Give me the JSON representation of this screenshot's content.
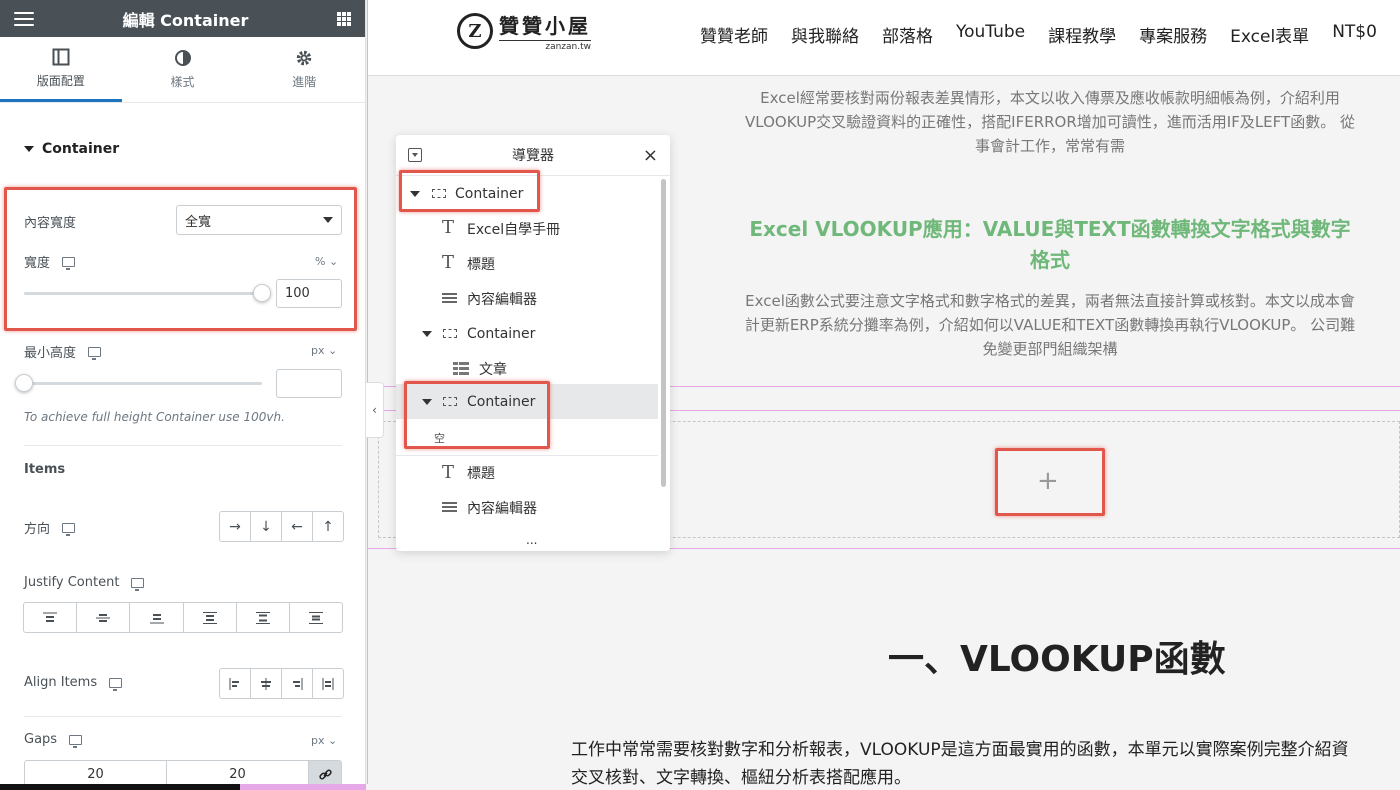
{
  "panel": {
    "title": "編輯 Container",
    "tabs": [
      {
        "label": "版面配置",
        "icon": "layout-icon",
        "active": true
      },
      {
        "label": "樣式",
        "icon": "style-icon",
        "active": false
      },
      {
        "label": "進階",
        "icon": "gear-icon",
        "active": false
      }
    ],
    "section_title": "Container",
    "content_width_label": "內容寬度",
    "content_width_value": "全寬",
    "width_label": "寬度",
    "width_unit": "%",
    "width_value": "100",
    "width_slider_fraction": 1.0,
    "min_height_label": "最小高度",
    "min_height_unit": "px",
    "min_height_value": "",
    "min_height_slider_fraction": 0.0,
    "min_height_hint": "To achieve full height Container use 100vh.",
    "items_title": "Items",
    "direction_label": "方向",
    "direction_options": [
      "→",
      "↓",
      "←",
      "↑"
    ],
    "justify_label": "Justify Content",
    "justify_options": [
      "justify-start",
      "justify-center",
      "justify-end",
      "justify-space-between",
      "justify-space-around",
      "justify-space-evenly"
    ],
    "align_label": "Align Items",
    "align_options": [
      "align-start",
      "align-center",
      "align-end",
      "align-stretch"
    ],
    "gaps_label": "Gaps",
    "gaps_unit": "px",
    "gap_column": "20",
    "gap_row": "20"
  },
  "site": {
    "logo_mark": "Z",
    "logo_name": "贊贊小屋",
    "logo_domain": "zanzan.tw",
    "nav": [
      "贊贊老師",
      "與我聯絡",
      "部落格",
      "YouTube",
      "課程教學",
      "專案服務",
      "Excel表單",
      "NT$0"
    ]
  },
  "content": {
    "para1": "Excel經常要核對兩份報表差異情形，本文以收入傳票及應收帳款明細帳為例，介紹利用VLOOKUP交叉驗證資料的正確性，搭配IFERROR增加可讀性，進而活用IF及LEFT函數。 從事會計工作，常常有需",
    "green_title": "Excel VLOOKUP應用：VALUE與TEXT函數轉換文字格式與數字格式",
    "para2": "Excel函數公式要注意文字格式和數字格式的差異，兩者無法直接計算或核對。本文以成本會計更新ERP系統分攤率為例，介紹如何以VALUE和TEXT函數轉換再執行VLOOKUP。 公司難免變更部門組織架構",
    "plus": "+",
    "h2": "一、VLOOKUP函數",
    "body_line1": "工作中常常需要核對數字和分析報表，VLOOKUP是這方面最實用的函數，本單元以實際案例完整介紹資",
    "body_line2": "交叉核對、文字轉換、樞紐分析表搭配應用。"
  },
  "navigator": {
    "title": "導覽器",
    "rows": [
      {
        "label": "Container",
        "type": "container",
        "level": 0,
        "expanded": true
      },
      {
        "label": "Excel自學手冊",
        "type": "heading",
        "level": 1
      },
      {
        "label": "標題",
        "type": "heading",
        "level": 1
      },
      {
        "label": "內容編輯器",
        "type": "text-editor",
        "level": 1
      },
      {
        "label": "Container",
        "type": "container",
        "level": 1,
        "expanded": true
      },
      {
        "label": "文章",
        "type": "posts",
        "level": 2
      },
      {
        "label": "Container",
        "type": "container",
        "level": 1,
        "expanded": true,
        "selected": true
      },
      {
        "label": "標題",
        "type": "heading",
        "level": 1
      },
      {
        "label": "內容編輯器",
        "type": "text-editor",
        "level": 1
      }
    ],
    "empty_label": "空",
    "more": "..."
  },
  "colors": {
    "highlight": "#e2574c",
    "green": "#6fb87a",
    "panel_header": "#495157",
    "active_tab": "#1e73be"
  }
}
